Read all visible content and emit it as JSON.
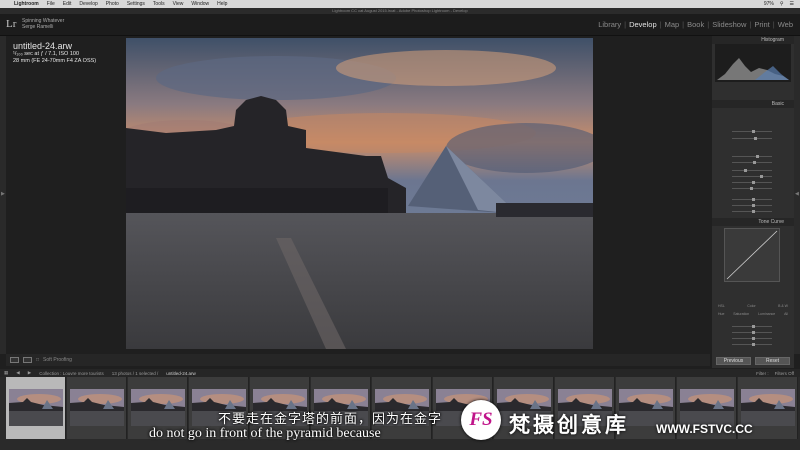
{
  "menubar": {
    "apple": "",
    "app": "Lightroom",
    "items": [
      "File",
      "Edit",
      "Develop",
      "Photo",
      "Settings",
      "Tools",
      "View",
      "Window",
      "Help"
    ],
    "battery": "97%"
  },
  "window_title": "Lightroom CC cat August 2015.lrcat - Adobe Photoshop Lightroom - Develop",
  "identity": {
    "logo": "Lr",
    "line1": "Spinning Whatever",
    "line2": "Serge Ramelli"
  },
  "modules": [
    "Library",
    "Develop",
    "Map",
    "Book",
    "Slideshow",
    "Print",
    "Web"
  ],
  "active_module": "Develop",
  "photo_info": {
    "filename": "untitled-24.arw",
    "exposure": "¹/₁₀₀ sec at ƒ / 7.1, ISO 100",
    "lens": "28 mm (FE 24-70mm F4 ZA OSS)"
  },
  "right_panel": {
    "histogram_label": "Histogram",
    "basic_label": "Basic",
    "tone_curve_label": "Tone Curve",
    "hsl_tabs": [
      "HSL",
      "Color",
      "B & W"
    ],
    "hsl_subtabs": [
      "Hue",
      "Saturation",
      "Luminance",
      "All"
    ],
    "previous_button": "Previous",
    "reset_button": "Reset"
  },
  "toolbar": {
    "soft_proofing": "Soft Proofing"
  },
  "filmstrip": {
    "source": "Collection : Louvre more tourists",
    "count": "13 photos / 1 selected /",
    "selected_file": "untitled-24.arw",
    "filter_label": "Filter :",
    "filter_value": "Filters Off"
  },
  "subtitles": {
    "chinese": "不要走在金字塔的前面，因为在金字",
    "english": "do not go in front of the pyramid because"
  },
  "watermark": {
    "logo": "FS",
    "name": "梵摄创意库",
    "url": "WWW.FSTVC.CC"
  }
}
